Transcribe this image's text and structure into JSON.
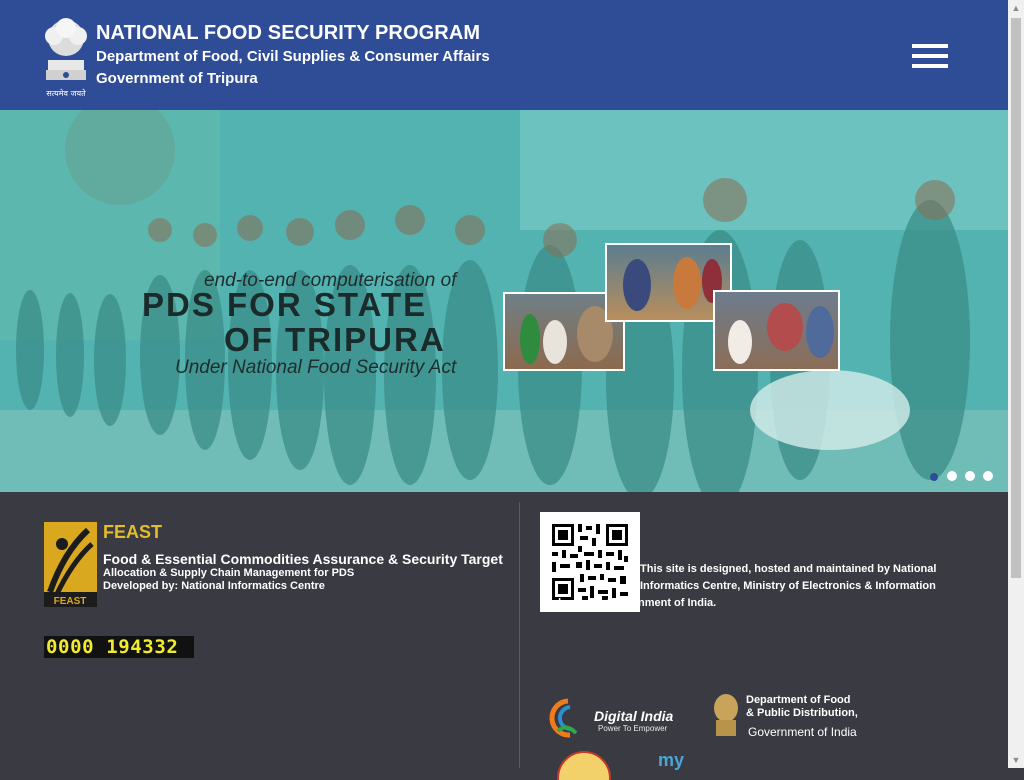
{
  "header": {
    "title": "NATIONAL FOOD SECURITY PROGRAM",
    "department": "Department of Food, Civil Supplies & Consumer Affairs",
    "government": "Government of Tripura",
    "emblem_caption": "सत्यमेव जयते",
    "menu_icon": "hamburger-menu-icon"
  },
  "banner": {
    "line1": "end-to-end computerisation of",
    "line2": "PDS FOR STATE",
    "line3": "OF TRIPURA",
    "line4": "Under National Food Security Act",
    "slide_count": 4,
    "active_slide": 1
  },
  "feast": {
    "title": "FEAST",
    "logo_text": "FEAST",
    "full_name": "Food & Essential Commodities Assurance & Security Target",
    "line1": "Allocation & Supply Chain Management for PDS",
    "line2": "Developed by: National Informatics Centre",
    "counter": "0000 194332"
  },
  "about": {
    "line1": "This site is designed, hosted and maintained by National",
    "line2": "Informatics Centre, Ministry of Electronics & Information",
    "line3": "Technology, Government of India."
  },
  "partners": {
    "digital_india": "Digital India",
    "digital_india_tag": "Power To Empower",
    "dfpd_line1": "Department of Food",
    "dfpd_line2": "& Public Distribution,",
    "dfpd_line3": "Government of India",
    "mygov": "my"
  },
  "colors": {
    "header_bg": "#2f4c96",
    "footer_bg": "#3a3a42",
    "feast_gold": "#e4bd2a",
    "counter_digits": "#f2ea2c"
  }
}
